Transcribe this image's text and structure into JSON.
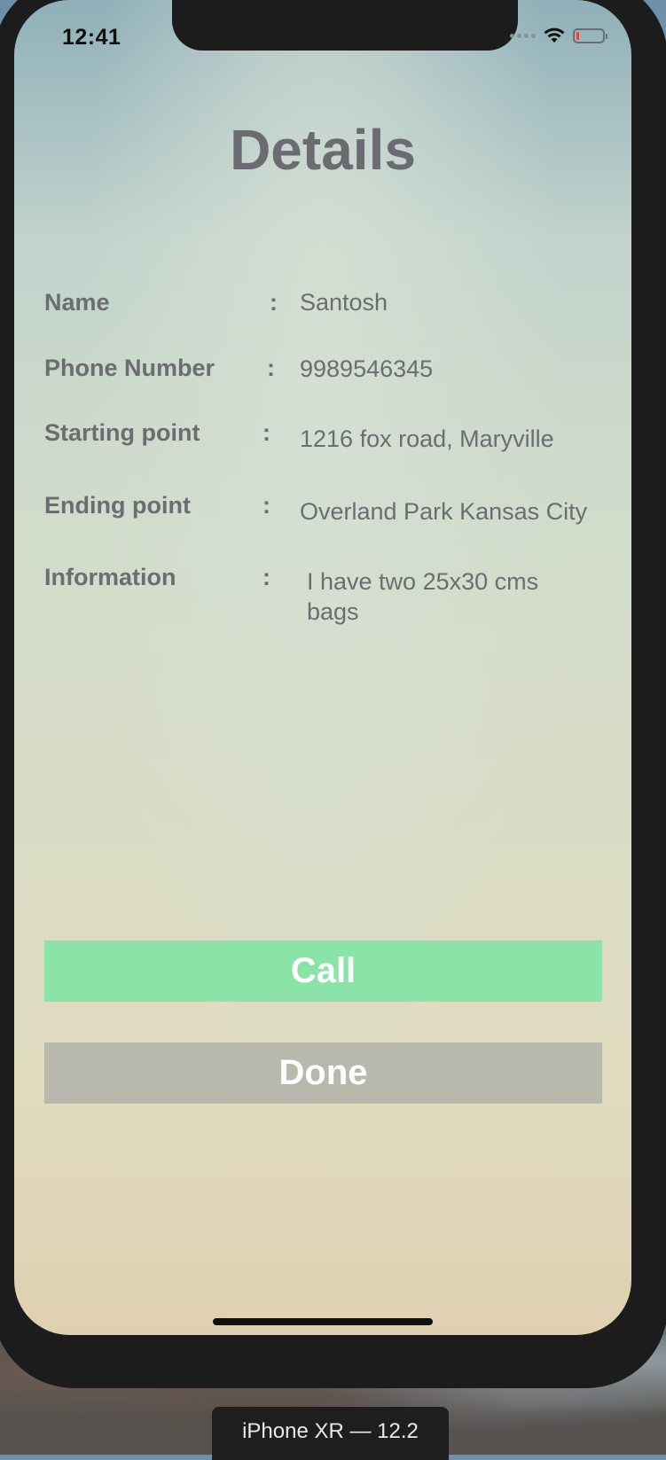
{
  "status_bar": {
    "time": "12:41"
  },
  "screen": {
    "title": "Details",
    "rows": [
      {
        "label": "Name",
        "value": "Santosh"
      },
      {
        "label": "Phone Number",
        "value": "9989546345"
      },
      {
        "label": "Starting point",
        "value": "1216 fox road, Maryville"
      },
      {
        "label": "Ending point",
        "value": "Overland Park Kansas City"
      },
      {
        "label": "Information",
        "value": "I have two 25x30 cms bags"
      }
    ],
    "separator": ":",
    "call_button": "Call",
    "done_button": "Done"
  },
  "simulator": {
    "device_label": "iPhone XR — 12.2"
  },
  "colors": {
    "call_button": "#8ae4a7",
    "done_button": "#b8b8ad",
    "text": "#6b6d70",
    "battery_low": "#e0443a"
  },
  "icons": {
    "wifi": "wifi-icon",
    "battery": "battery-icon",
    "signal": "cellular-signal-icon"
  }
}
